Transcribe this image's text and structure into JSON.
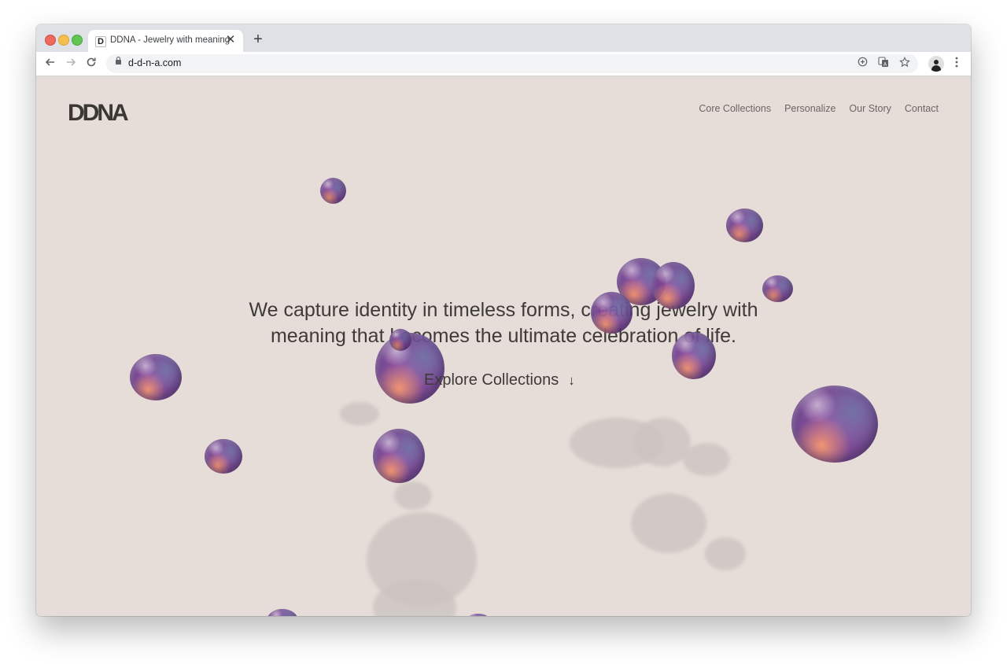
{
  "browser": {
    "tab": {
      "favicon_letter": "D",
      "title": "DDNA - Jewelry with meaning",
      "close_glyph": "✕"
    },
    "new_tab_glyph": "+",
    "url": "d-d-n-a.com",
    "icons": [
      "back-icon",
      "forward-icon",
      "reload-icon",
      "lock-icon",
      "zoom-icon",
      "translate-icon",
      "star-icon",
      "avatar",
      "menu-icon"
    ]
  },
  "site": {
    "logo": "DDNA",
    "nav": {
      "items": [
        {
          "label": "Core Collections"
        },
        {
          "label": "Personalize"
        },
        {
          "label": "Our Story"
        },
        {
          "label": "Contact"
        }
      ]
    },
    "hero": {
      "line1": "We capture identity in timeless forms, creating jewelry with",
      "line2": "meaning that becomes the ultimate celebration of life."
    },
    "cta": {
      "label": "Explore Collections",
      "arrow": "↓"
    }
  },
  "colors": {
    "page_background": "#e6ddd8",
    "text": "#3e3a39",
    "nav_text": "#6b6563",
    "bubble_primary": "#9a4ea8",
    "bubble_highlight": "#f38f6b"
  }
}
